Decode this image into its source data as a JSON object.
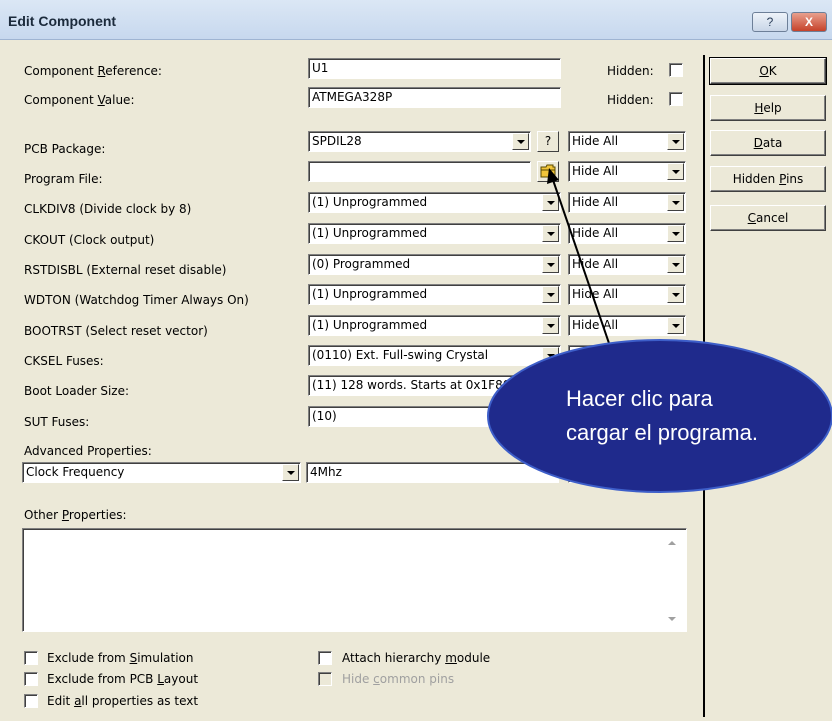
{
  "window": {
    "title": "Edit Component",
    "help_button": "?",
    "close_button": "X"
  },
  "fields": {
    "component_reference": {
      "label_pre": "Component ",
      "label_ul": "R",
      "label_post": "eference:",
      "value": "U1",
      "hidden_label": "Hidden:"
    },
    "component_value": {
      "label_pre": "Component ",
      "label_ul": "V",
      "label_post": "alue:",
      "value": "ATMEGA328P",
      "hidden_label": "Hidden:"
    },
    "pcb_package": {
      "label": "PCB Package:",
      "value": "SPDIL28",
      "q_button": "?",
      "visibility": "Hide All"
    },
    "program_file": {
      "label": "Program File:",
      "value": "",
      "visibility": "Hide All"
    },
    "clkdiv8": {
      "label": "CLKDIV8 (Divide clock by 8)",
      "value": "(1) Unprogrammed",
      "visibility": "Hide All"
    },
    "ckout": {
      "label": "CKOUT (Clock output)",
      "value": "(1) Unprogrammed",
      "visibility": "Hide All"
    },
    "rstdisbl": {
      "label": "RSTDISBL (External reset disable)",
      "value": "(0) Programmed",
      "visibility": "Hide All"
    },
    "wdton": {
      "label": "WDTON (Watchdog Timer Always On)",
      "value": "(1) Unprogrammed",
      "visibility": "Hide All"
    },
    "bootrst": {
      "label": "BOOTRST (Select reset vector)",
      "value": "(1) Unprogrammed",
      "visibility": "Hide All"
    },
    "cksel": {
      "label": "CKSEL Fuses:",
      "value": "(0110) Ext. Full-swing Crystal",
      "visibility": "Hid"
    },
    "boot_loader_size": {
      "label": "Boot Loader Size:",
      "value": "(11) 128 words. Starts at 0x1F80"
    },
    "sut_fuses": {
      "label": "SUT Fuses:",
      "value": "(10)"
    },
    "advanced_properties": {
      "label": "Advanced Properties:",
      "property": "Clock Frequency",
      "value": "4Mhz"
    },
    "other_properties": {
      "label_pre": "Other ",
      "label_ul": "P",
      "label_post": "roperties:"
    }
  },
  "buttons": {
    "ok": {
      "pre": "",
      "ul": "O",
      "post": "K"
    },
    "help": {
      "pre": "",
      "ul": "H",
      "post": "elp"
    },
    "data": {
      "pre": "",
      "ul": "D",
      "post": "ata"
    },
    "hidden_pins": {
      "pre": "Hidden ",
      "ul": "P",
      "post": "ins"
    },
    "cancel": {
      "pre": "",
      "ul": "C",
      "post": "ancel"
    }
  },
  "checkboxes": {
    "exclude_simulation": {
      "pre": "Exclude from ",
      "ul": "S",
      "post": "imulation"
    },
    "exclude_pcb": {
      "pre": "Exclude from PCB ",
      "ul": "L",
      "post": "ayout"
    },
    "edit_text": {
      "pre": "Edit ",
      "ul": "a",
      "post": "ll properties as text"
    },
    "attach_hierarchy": {
      "pre": "Attach hierarchy ",
      "ul": "m",
      "post": "odule"
    },
    "hide_common_pins": {
      "pre": "Hide ",
      "ul": "c",
      "post": "ommon pins"
    }
  },
  "callout": {
    "line1": "Hacer clic para",
    "line2": "cargar el programa.",
    "color": "#1f2a8c"
  }
}
